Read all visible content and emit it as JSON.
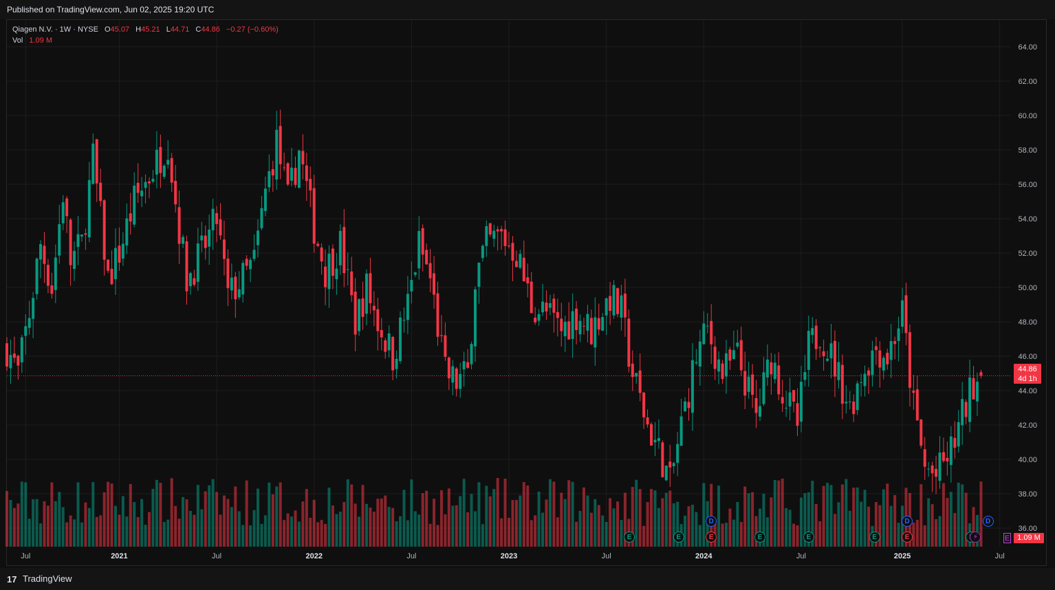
{
  "header": {
    "published": "Published on TradingView.com, Jun 02, 2025 19:20 UTC"
  },
  "legend": {
    "symbol": "Qiagen N.V. · 1W · NYSE",
    "o_label": "O",
    "o_val": "45.07",
    "h_label": "H",
    "h_val": "45.21",
    "l_label": "L",
    "l_val": "44.71",
    "c_label": "C",
    "c_val": "44.86",
    "change": "−0.27 (−0.60%)",
    "vol_label": "Vol",
    "vol_val": "1.09 M"
  },
  "price_tag": {
    "price": "44.86",
    "countdown": "4d 1h"
  },
  "vol_tag": "1.09 M",
  "footer": {
    "logo_glyph": "17",
    "brand": "TradingView"
  },
  "colors": {
    "up": "#089981",
    "down": "#f23645",
    "bg": "#0f0f0f",
    "grid": "#1e1e1e",
    "axis_text": "#b2b5be",
    "event_d": "#2962ff",
    "event_s": "#9c27b0"
  },
  "event_markers": [
    {
      "label": "E",
      "kind": "e",
      "date": "2023-08"
    },
    {
      "label": "E",
      "kind": "e",
      "date": "2023-11"
    },
    {
      "label": "D",
      "kind": "d",
      "date": "2024-01"
    },
    {
      "label": "E",
      "kind": "er",
      "date": "2024-01"
    },
    {
      "label": "E",
      "kind": "e",
      "date": "2024-04"
    },
    {
      "label": "E",
      "kind": "e",
      "date": "2024-07"
    },
    {
      "label": "E",
      "kind": "e",
      "date": "2024-11"
    },
    {
      "label": "D",
      "kind": "d",
      "date": "2025-01"
    },
    {
      "label": "E",
      "kind": "er",
      "date": "2025-01"
    },
    {
      "label": "E",
      "kind": "e",
      "date": "2025-05"
    },
    {
      "label": "⚡",
      "kind": "s",
      "date": "2025-05"
    },
    {
      "label": "D",
      "kind": "d",
      "date": "2025-06"
    },
    {
      "label": "E",
      "kind": "purple",
      "date": "2025-06"
    }
  ],
  "chart_data": {
    "type": "candlestick",
    "title": "Qiagen N.V. · 1W · NYSE",
    "interval": "1W",
    "y_ticks": [
      "36.00",
      "38.00",
      "40.00",
      "42.00",
      "44.00",
      "46.00",
      "48.00",
      "50.00",
      "52.00",
      "54.00",
      "56.00",
      "58.00",
      "60.00",
      "62.00",
      "64.00"
    ],
    "ylim": [
      35.0,
      64.5
    ],
    "x_ticks": [
      "Jul",
      "2021",
      "Jul",
      "2022",
      "Jul",
      "2023",
      "Jul",
      "2024",
      "Jul",
      "2025",
      "Jul"
    ],
    "x_range": [
      "2020-06-08",
      "2025-07-28"
    ],
    "last_close": 44.86,
    "volume_last": "1.09 M",
    "series": [
      {
        "name": "price",
        "anchors": [
          [
            "2020-06-08",
            46.5
          ],
          [
            "2020-06-29",
            45.0
          ],
          [
            "2020-07-20",
            48.5
          ],
          [
            "2020-08-10",
            52.5
          ],
          [
            "2020-08-31",
            50.0
          ],
          [
            "2020-09-21",
            55.5
          ],
          [
            "2020-10-05",
            51.5
          ],
          [
            "2020-10-26",
            52.5
          ],
          [
            "2020-11-16",
            57.5
          ],
          [
            "2020-12-14",
            50.5
          ],
          [
            "2021-01-04",
            52.0
          ],
          [
            "2021-02-01",
            55.0
          ],
          [
            "2021-03-01",
            56.5
          ],
          [
            "2021-04-05",
            58.5
          ],
          [
            "2021-04-19",
            55.0
          ],
          [
            "2021-05-10",
            50.5
          ],
          [
            "2021-06-07",
            52.0
          ],
          [
            "2021-07-05",
            54.0
          ],
          [
            "2021-07-26",
            49.5
          ],
          [
            "2021-08-23",
            50.5
          ],
          [
            "2021-09-13",
            51.5
          ],
          [
            "2021-10-04",
            55.5
          ],
          [
            "2021-10-25",
            58.5
          ],
          [
            "2021-11-15",
            55.0
          ],
          [
            "2021-12-06",
            58.0
          ],
          [
            "2022-01-03",
            53.5
          ],
          [
            "2022-01-24",
            51.0
          ],
          [
            "2022-02-21",
            52.5
          ],
          [
            "2022-03-21",
            48.0
          ],
          [
            "2022-04-11",
            50.0
          ],
          [
            "2022-05-02",
            48.0
          ],
          [
            "2022-05-30",
            46.0
          ],
          [
            "2022-06-27",
            49.0
          ],
          [
            "2022-07-18",
            52.5
          ],
          [
            "2022-08-08",
            50.5
          ],
          [
            "2022-09-05",
            45.0
          ],
          [
            "2022-09-26",
            44.5
          ],
          [
            "2022-10-17",
            45.0
          ],
          [
            "2022-10-31",
            50.5
          ],
          [
            "2022-11-21",
            52.5
          ],
          [
            "2022-12-19",
            53.0
          ],
          [
            "2023-01-16",
            52.0
          ],
          [
            "2023-02-13",
            49.0
          ],
          [
            "2023-03-13",
            48.5
          ],
          [
            "2023-04-10",
            47.5
          ],
          [
            "2023-05-08",
            48.5
          ],
          [
            "2023-06-05",
            47.5
          ],
          [
            "2023-07-10",
            49.5
          ],
          [
            "2023-07-31",
            48.5
          ],
          [
            "2023-08-21",
            45.0
          ],
          [
            "2023-09-18",
            42.0
          ],
          [
            "2023-10-16",
            40.0
          ],
          [
            "2023-10-30",
            38.5
          ],
          [
            "2023-11-20",
            42.0
          ],
          [
            "2023-12-18",
            46.0
          ],
          [
            "2024-01-08",
            47.5
          ],
          [
            "2024-02-05",
            45.0
          ],
          [
            "2024-03-04",
            46.0
          ],
          [
            "2024-04-08",
            42.5
          ],
          [
            "2024-05-06",
            46.0
          ],
          [
            "2024-05-27",
            44.0
          ],
          [
            "2024-06-24",
            42.0
          ],
          [
            "2024-07-15",
            46.5
          ],
          [
            "2024-08-05",
            47.5
          ],
          [
            "2024-09-02",
            45.5
          ],
          [
            "2024-09-30",
            43.0
          ],
          [
            "2024-10-21",
            45.0
          ],
          [
            "2024-11-18",
            46.5
          ],
          [
            "2024-12-09",
            46.0
          ],
          [
            "2025-01-06",
            48.5
          ],
          [
            "2025-01-27",
            43.0
          ],
          [
            "2025-02-17",
            39.5
          ],
          [
            "2025-03-10",
            39.0
          ],
          [
            "2025-04-07",
            40.5
          ],
          [
            "2025-04-28",
            42.5
          ],
          [
            "2025-05-19",
            44.5
          ],
          [
            "2025-06-02",
            44.86
          ]
        ]
      }
    ]
  }
}
